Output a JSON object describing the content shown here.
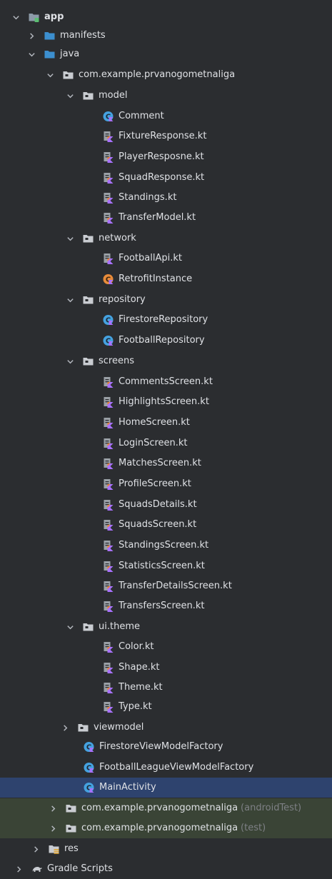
{
  "tree": {
    "rows": [
      {
        "label": "app",
        "suffix": "",
        "icon": "module-folder-icon",
        "expanded": true,
        "has_chevron": true,
        "bold": true
      },
      {
        "label": "manifests",
        "suffix": "",
        "icon": "folder-icon",
        "expanded": false,
        "has_chevron": true
      },
      {
        "label": "java",
        "suffix": "",
        "icon": "source-folder-icon",
        "expanded": true,
        "has_chevron": true
      },
      {
        "label": "com.example.prvanogometnaliga",
        "suffix": "",
        "icon": "package-icon",
        "expanded": true,
        "has_chevron": true
      },
      {
        "label": "model",
        "suffix": "",
        "icon": "package-icon",
        "expanded": true,
        "has_chevron": true
      },
      {
        "label": "Comment",
        "suffix": "",
        "icon": "kotlin-class-icon",
        "has_chevron": false
      },
      {
        "label": "FixtureResponse.kt",
        "suffix": "",
        "icon": "kotlin-file-icon",
        "has_chevron": false
      },
      {
        "label": "PlayerResposne.kt",
        "suffix": "",
        "icon": "kotlin-file-icon",
        "has_chevron": false
      },
      {
        "label": "SquadResponse.kt",
        "suffix": "",
        "icon": "kotlin-file-icon",
        "has_chevron": false
      },
      {
        "label": "Standings.kt",
        "suffix": "",
        "icon": "kotlin-file-icon",
        "has_chevron": false
      },
      {
        "label": "TransferModel.kt",
        "suffix": "",
        "icon": "kotlin-file-icon",
        "has_chevron": false
      },
      {
        "label": "network",
        "suffix": "",
        "icon": "package-icon",
        "expanded": true,
        "has_chevron": true
      },
      {
        "label": "FootballApi.kt",
        "suffix": "",
        "icon": "kotlin-file-icon",
        "has_chevron": false
      },
      {
        "label": "RetrofitInstance",
        "suffix": "",
        "icon": "kotlin-object-icon",
        "has_chevron": false
      },
      {
        "label": "repository",
        "suffix": "",
        "icon": "package-icon",
        "expanded": true,
        "has_chevron": true
      },
      {
        "label": "FirestoreRepository",
        "suffix": "",
        "icon": "kotlin-class-icon",
        "has_chevron": false
      },
      {
        "label": "FootballRepository",
        "suffix": "",
        "icon": "kotlin-class-icon",
        "has_chevron": false
      },
      {
        "label": "screens",
        "suffix": "",
        "icon": "package-icon",
        "expanded": true,
        "has_chevron": true
      },
      {
        "label": "CommentsScreen.kt",
        "suffix": "",
        "icon": "kotlin-file-icon",
        "has_chevron": false
      },
      {
        "label": "HighlightsScreen.kt",
        "suffix": "",
        "icon": "kotlin-file-icon",
        "has_chevron": false
      },
      {
        "label": "HomeScreen.kt",
        "suffix": "",
        "icon": "kotlin-file-icon",
        "has_chevron": false
      },
      {
        "label": "LoginScreen.kt",
        "suffix": "",
        "icon": "kotlin-file-icon",
        "has_chevron": false
      },
      {
        "label": "MatchesScreen.kt",
        "suffix": "",
        "icon": "kotlin-file-icon",
        "has_chevron": false
      },
      {
        "label": "ProfileScreen.kt",
        "suffix": "",
        "icon": "kotlin-file-icon",
        "has_chevron": false
      },
      {
        "label": "SquadsDetails.kt",
        "suffix": "",
        "icon": "kotlin-file-icon",
        "has_chevron": false
      },
      {
        "label": "SquadsScreen.kt",
        "suffix": "",
        "icon": "kotlin-file-icon",
        "has_chevron": false
      },
      {
        "label": "StandingsScreen.kt",
        "suffix": "",
        "icon": "kotlin-file-icon",
        "has_chevron": false
      },
      {
        "label": "StatisticsScreen.kt",
        "suffix": "",
        "icon": "kotlin-file-icon",
        "has_chevron": false
      },
      {
        "label": "TransferDetailsScreen.kt",
        "suffix": "",
        "icon": "kotlin-file-icon",
        "has_chevron": false
      },
      {
        "label": "TransfersScreen.kt",
        "suffix": "",
        "icon": "kotlin-file-icon",
        "has_chevron": false
      },
      {
        "label": "ui.theme",
        "suffix": "",
        "icon": "package-icon",
        "expanded": true,
        "has_chevron": true
      },
      {
        "label": "Color.kt",
        "suffix": "",
        "icon": "kotlin-file-icon",
        "has_chevron": false
      },
      {
        "label": "Shape.kt",
        "suffix": "",
        "icon": "kotlin-file-icon",
        "has_chevron": false
      },
      {
        "label": "Theme.kt",
        "suffix": "",
        "icon": "kotlin-file-icon",
        "has_chevron": false
      },
      {
        "label": "Type.kt",
        "suffix": "",
        "icon": "kotlin-file-icon",
        "has_chevron": false
      },
      {
        "label": "viewmodel",
        "suffix": "",
        "icon": "package-icon",
        "expanded": false,
        "has_chevron": true
      },
      {
        "label": "FirestoreViewModelFactory",
        "suffix": "",
        "icon": "kotlin-class-icon",
        "has_chevron": false
      },
      {
        "label": "FootballLeagueViewModelFactory",
        "suffix": "",
        "icon": "kotlin-class-icon",
        "has_chevron": false
      },
      {
        "label": "MainActivity",
        "suffix": "",
        "icon": "kotlin-class-icon",
        "has_chevron": false,
        "selected": true
      },
      {
        "label": "com.example.prvanogometnaliga",
        "suffix": "(androidTest)",
        "icon": "package-icon",
        "expanded": false,
        "has_chevron": true,
        "tinted": true
      },
      {
        "label": "com.example.prvanogometnaliga",
        "suffix": "(test)",
        "icon": "package-icon",
        "expanded": false,
        "has_chevron": true,
        "tinted": true
      },
      {
        "label": "res",
        "suffix": "",
        "icon": "resource-folder-icon",
        "expanded": false,
        "has_chevron": true
      },
      {
        "label": "Gradle Scripts",
        "suffix": "",
        "icon": "gradle-icon",
        "expanded": false,
        "has_chevron": true
      }
    ]
  },
  "colors": {
    "background": "#2b2d30",
    "selected_row": "#2e436e",
    "test_row": "#3a4436",
    "folder_blue": "#3c8fcf",
    "kotlin_purple": "#a972ff",
    "kotlin_orange": "#e8813a",
    "class_blue": "#45a2e0",
    "object_orange": "#e98c3a",
    "text": "#dfe1e5",
    "muted": "#7e8085"
  }
}
